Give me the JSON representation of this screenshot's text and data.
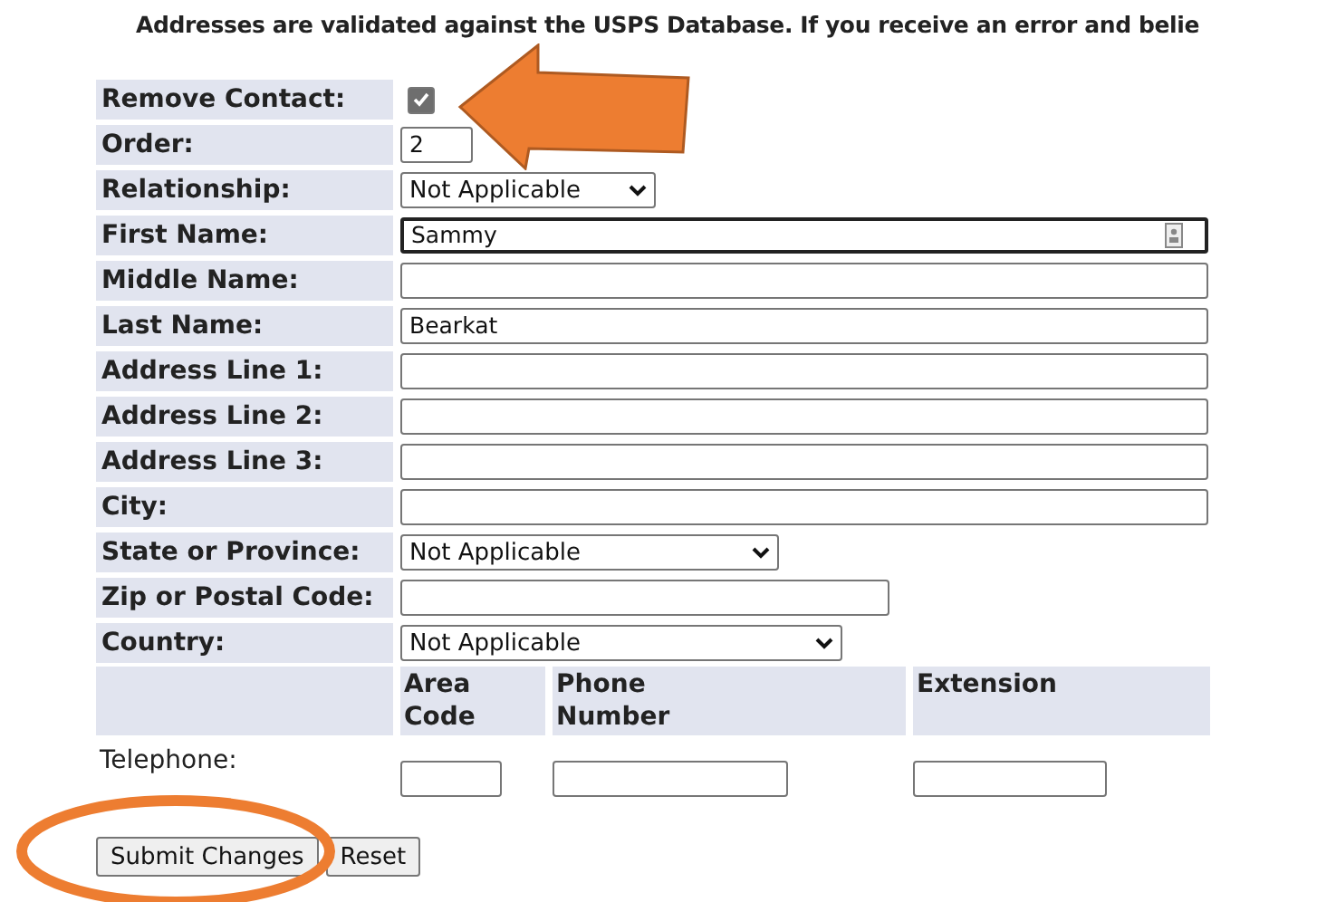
{
  "notice": "Addresses are validated against the USPS Database. If you receive an error and belie",
  "fields": [
    {
      "label": "Remove Contact:",
      "kind": "checkbox",
      "checked": true
    },
    {
      "label": "Order:",
      "kind": "text",
      "value": "2"
    },
    {
      "label": "Relationship:",
      "kind": "select",
      "value": "Not Applicable"
    },
    {
      "label": "First Name:",
      "kind": "text",
      "value": "Sammy",
      "focused": true
    },
    {
      "label": "Middle Name:",
      "kind": "text",
      "focused": false
    },
    {
      "label": "Last Name:",
      "kind": "text",
      "value": "Bearkat",
      "focused": false
    },
    {
      "label": "Address Line 1:",
      "kind": "text",
      "focused": false
    },
    {
      "label": "Address Line 2:",
      "kind": "text",
      "focused": false
    },
    {
      "label": "Address Line 3:",
      "kind": "text",
      "focused": false
    },
    {
      "label": "City:",
      "kind": "text",
      "focused": false
    },
    {
      "label": "State or Province:",
      "kind": "select",
      "value": "Not Applicable"
    },
    {
      "label": "Zip or Postal Code:",
      "kind": "text",
      "focused": false
    },
    {
      "label": "Country:",
      "kind": "select",
      "value": "Not Applicable"
    }
  ],
  "telephone": {
    "label": "Telephone:",
    "columns": [
      "Area Code",
      "Phone Number",
      "Extension"
    ]
  },
  "buttons": [
    "Submit Changes",
    "Reset"
  ]
}
